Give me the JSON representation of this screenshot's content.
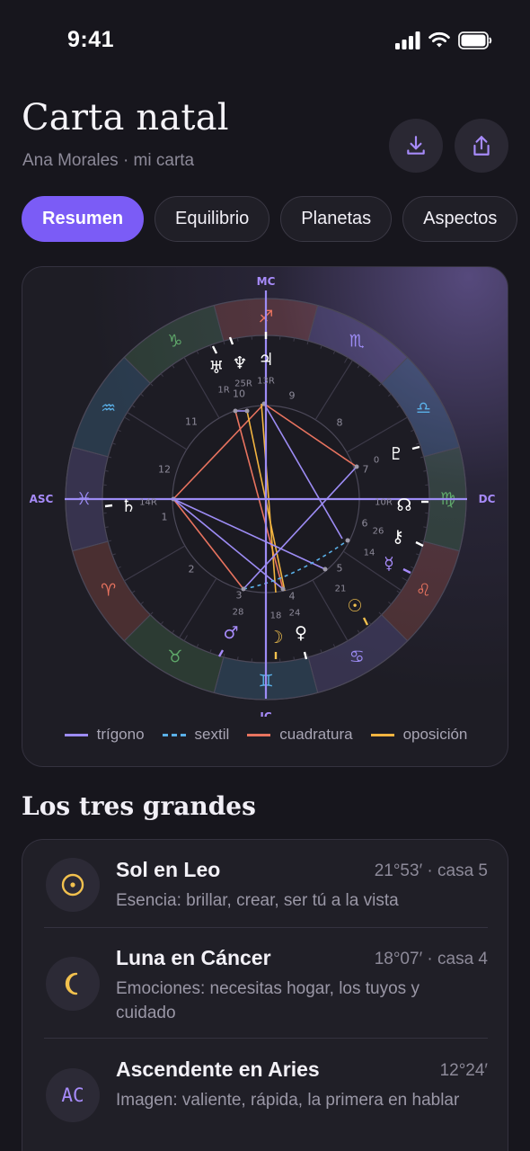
{
  "status_bar": {
    "time": "9:41"
  },
  "header": {
    "title": "Carta natal",
    "subtitle": "Ana Morales · mi carta",
    "download_icon": "download-icon",
    "share_icon": "share-icon"
  },
  "tabs": [
    {
      "label": "Resumen",
      "active": true
    },
    {
      "label": "Equilibrio",
      "active": false
    },
    {
      "label": "Planetas",
      "active": false
    },
    {
      "label": "Aspectos",
      "active": false
    }
  ],
  "chart": {
    "axes": {
      "mc": "MC",
      "ic": "IC",
      "asc": "ASC",
      "dc": "DC"
    },
    "signs": [
      "♈",
      "♉",
      "♊",
      "♋",
      "♌",
      "♍",
      "♎",
      "♏",
      "♐",
      "♑",
      "♒",
      "♓"
    ],
    "house_numbers": [
      "1",
      "2",
      "3",
      "4",
      "5",
      "6",
      "7",
      "8",
      "9",
      "10",
      "11",
      "12"
    ],
    "planets": [
      {
        "glyph": "♄",
        "degree": "14R",
        "color": "#ffffff"
      },
      {
        "glyph": "♅",
        "degree": "1R",
        "color": "#ffffff"
      },
      {
        "glyph": "♆",
        "degree": "25R",
        "color": "#ffffff"
      },
      {
        "glyph": "♃",
        "degree": "13R",
        "color": "#ffffff"
      },
      {
        "glyph": "♇",
        "degree": "0",
        "color": "#ffffff"
      },
      {
        "glyph": "☊",
        "degree": "10R",
        "color": "#ffffff"
      },
      {
        "glyph": "⚷",
        "degree": "26",
        "color": "#ffffff"
      },
      {
        "glyph": "☿",
        "degree": "14",
        "color": "#a78bfa"
      },
      {
        "glyph": "☉",
        "degree": "21",
        "color": "#f2c14e"
      },
      {
        "glyph": "☽",
        "degree": "18",
        "color": "#f2c14e"
      },
      {
        "glyph": "♀",
        "degree": "24",
        "color": "#ffffff"
      },
      {
        "glyph": "♂",
        "degree": "28",
        "color": "#a78bfa"
      }
    ],
    "legend": [
      {
        "label": "trígono",
        "color": "#9d8cf5",
        "style": "solid"
      },
      {
        "label": "sextil",
        "color": "#5ab0e8",
        "style": "dashed"
      },
      {
        "label": "cuadratura",
        "color": "#e8735f",
        "style": "solid"
      },
      {
        "label": "oposición",
        "color": "#f2b440",
        "style": "solid"
      }
    ]
  },
  "big_three": {
    "title": "Los tres grandes",
    "items": [
      {
        "icon": "sun-icon",
        "glyph": "☉",
        "title": "Sol en Leo",
        "meta": "21°53′ · casa 5",
        "desc": "Esencia: brillar, crear, ser tú a la vista"
      },
      {
        "icon": "moon-icon",
        "glyph": "☾",
        "title": "Luna en Cáncer",
        "meta": "18°07′ · casa 4",
        "desc": "Emociones: necesitas hogar, los tuyos y cuidado"
      },
      {
        "icon": "ascendant-icon",
        "glyph": "AC",
        "title": "Ascendente en Aries",
        "meta": "12°24′",
        "desc": "Imagen: valiente, rápida, la primera en hablar"
      }
    ]
  }
}
